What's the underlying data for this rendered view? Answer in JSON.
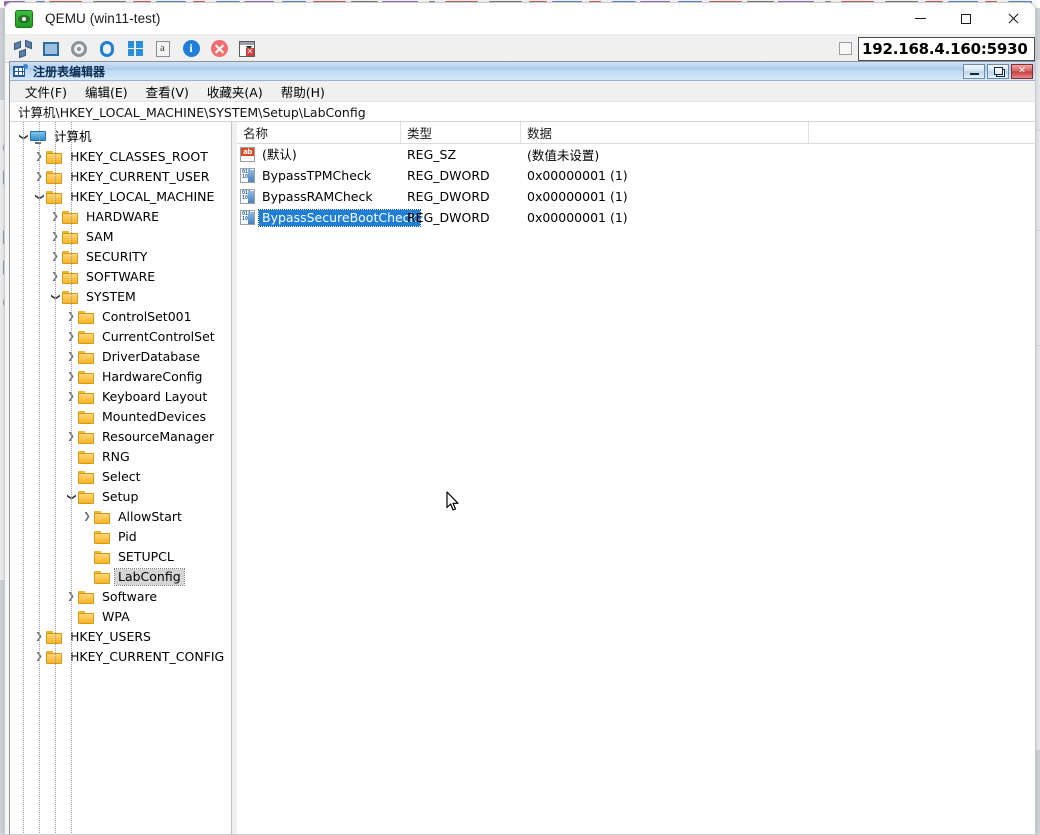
{
  "qemu": {
    "title": "QEMU (win11-test)",
    "icon": "qemu-logo-icon",
    "window_controls": {
      "minimize": "—",
      "maximize": "□",
      "close": "✕"
    },
    "toolbar": [
      {
        "name": "network-icon",
        "tip": "Network"
      },
      {
        "name": "fullscreen-icon",
        "tip": "Fullscreen"
      },
      {
        "name": "gear-icon",
        "tip": "Settings"
      },
      {
        "name": "refresh-icon",
        "tip": "Refresh"
      },
      {
        "name": "windows-logo-icon",
        "tip": "Send key"
      },
      {
        "name": "document-icon",
        "tip": "Screenshot"
      },
      {
        "name": "info-icon",
        "tip": "Info"
      },
      {
        "name": "stop-icon",
        "tip": "Stop"
      },
      {
        "name": "close-window-icon",
        "tip": "Close window"
      }
    ],
    "address_value": "192.168.4.160:5930",
    "checkbox_checked": false
  },
  "regedit": {
    "title": "注册表编辑器",
    "icon": "registry-icon",
    "window_buttons": {
      "minimize": "minimize-icon",
      "restore": "restore-icon",
      "close": "✕"
    },
    "menus": [
      {
        "label": "文件(F)"
      },
      {
        "label": "编辑(E)"
      },
      {
        "label": "查看(V)"
      },
      {
        "label": "收藏夹(A)"
      },
      {
        "label": "帮助(H)"
      }
    ],
    "address_path": "计算机\\HKEY_LOCAL_MACHINE\\SYSTEM\\Setup\\LabConfig",
    "tree": [
      {
        "label": "计算机",
        "depth": 0,
        "state": "open",
        "icon": "computer-icon",
        "selected": false
      },
      {
        "label": "HKEY_CLASSES_ROOT",
        "depth": 1,
        "state": "closed",
        "icon": "folder-icon",
        "selected": false
      },
      {
        "label": "HKEY_CURRENT_USER",
        "depth": 1,
        "state": "closed",
        "icon": "folder-icon",
        "selected": false
      },
      {
        "label": "HKEY_LOCAL_MACHINE",
        "depth": 1,
        "state": "open",
        "icon": "folder-icon",
        "selected": false
      },
      {
        "label": "HARDWARE",
        "depth": 2,
        "state": "closed",
        "icon": "folder-icon",
        "selected": false
      },
      {
        "label": "SAM",
        "depth": 2,
        "state": "closed",
        "icon": "folder-icon",
        "selected": false
      },
      {
        "label": "SECURITY",
        "depth": 2,
        "state": "closed",
        "icon": "folder-icon",
        "selected": false
      },
      {
        "label": "SOFTWARE",
        "depth": 2,
        "state": "closed",
        "icon": "folder-icon",
        "selected": false
      },
      {
        "label": "SYSTEM",
        "depth": 2,
        "state": "open",
        "icon": "folder-icon",
        "selected": false
      },
      {
        "label": "ControlSet001",
        "depth": 3,
        "state": "closed",
        "icon": "folder-icon",
        "selected": false
      },
      {
        "label": "CurrentControlSet",
        "depth": 3,
        "state": "closed",
        "icon": "folder-icon",
        "selected": false
      },
      {
        "label": "DriverDatabase",
        "depth": 3,
        "state": "closed",
        "icon": "folder-icon",
        "selected": false
      },
      {
        "label": "HardwareConfig",
        "depth": 3,
        "state": "closed",
        "icon": "folder-icon",
        "selected": false
      },
      {
        "label": "Keyboard Layout",
        "depth": 3,
        "state": "closed",
        "icon": "folder-icon",
        "selected": false
      },
      {
        "label": "MountedDevices",
        "depth": 3,
        "state": "leaf",
        "icon": "folder-icon",
        "selected": false
      },
      {
        "label": "ResourceManager",
        "depth": 3,
        "state": "closed",
        "icon": "folder-icon",
        "selected": false
      },
      {
        "label": "RNG",
        "depth": 3,
        "state": "leaf",
        "icon": "folder-icon",
        "selected": false
      },
      {
        "label": "Select",
        "depth": 3,
        "state": "leaf",
        "icon": "folder-icon",
        "selected": false
      },
      {
        "label": "Setup",
        "depth": 3,
        "state": "open",
        "icon": "folder-icon",
        "selected": false
      },
      {
        "label": "AllowStart",
        "depth": 4,
        "state": "closed",
        "icon": "folder-icon",
        "selected": false
      },
      {
        "label": "Pid",
        "depth": 4,
        "state": "leaf",
        "icon": "folder-icon",
        "selected": false
      },
      {
        "label": "SETUPCL",
        "depth": 4,
        "state": "leaf",
        "icon": "folder-icon",
        "selected": false
      },
      {
        "label": "LabConfig",
        "depth": 4,
        "state": "leaf",
        "icon": "folder-icon",
        "selected": true
      },
      {
        "label": "Software",
        "depth": 3,
        "state": "closed",
        "icon": "folder-icon",
        "selected": false
      },
      {
        "label": "WPA",
        "depth": 3,
        "state": "leaf",
        "icon": "folder-icon",
        "selected": false
      },
      {
        "label": "HKEY_USERS",
        "depth": 1,
        "state": "closed",
        "icon": "folder-icon",
        "selected": false
      },
      {
        "label": "HKEY_CURRENT_CONFIG",
        "depth": 1,
        "state": "closed",
        "icon": "folder-icon",
        "selected": false
      }
    ],
    "columns": [
      {
        "label": "名称"
      },
      {
        "label": "类型"
      },
      {
        "label": "数据"
      }
    ],
    "values": [
      {
        "name": "(默认)",
        "type": "REG_SZ",
        "data": "(数值未设置)",
        "icon": "string-value-icon",
        "selected": false
      },
      {
        "name": "BypassTPMCheck",
        "type": "REG_DWORD",
        "data": "0x00000001 (1)",
        "icon": "dword-value-icon",
        "selected": false
      },
      {
        "name": "BypassRAMCheck",
        "type": "REG_DWORD",
        "data": "0x00000001 (1)",
        "icon": "dword-value-icon",
        "selected": false
      },
      {
        "name": "BypassSecureBootCheck",
        "type": "REG_DWORD",
        "data": "0x00000001 (1)",
        "icon": "dword-value-icon",
        "selected": true
      }
    ]
  },
  "colors": {
    "selection_blue": "#1f7fd6",
    "tree_selection_gray": "#d5d5d5",
    "title_blue": "#a8c9ea",
    "folder_yellow": "#f6b429",
    "accent_orange": "#e8552c"
  }
}
